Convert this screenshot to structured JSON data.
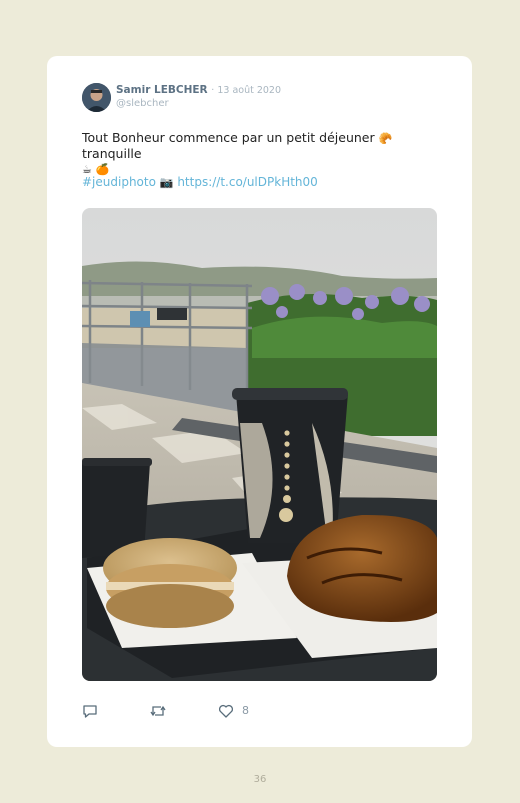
{
  "tweet": {
    "author_name": "Samir LEBCHER",
    "date": "· 13 août 2020",
    "handle": "@slebcher",
    "text": "Tout Bonheur commence par un petit déjeuner",
    "text_emoji_1": "🥐",
    "text_word": "tranquille",
    "text_emoji_2": "☕",
    "text_emoji_3": "🍊",
    "hashtag": "#jeudiphoto",
    "camera_emoji": "📷",
    "link": "https://t.co/ulDPkHth00",
    "likes": "8"
  },
  "icons": {
    "reply": "reply-icon",
    "retweet": "retweet-icon",
    "like": "heart-icon"
  },
  "page_number": "36"
}
